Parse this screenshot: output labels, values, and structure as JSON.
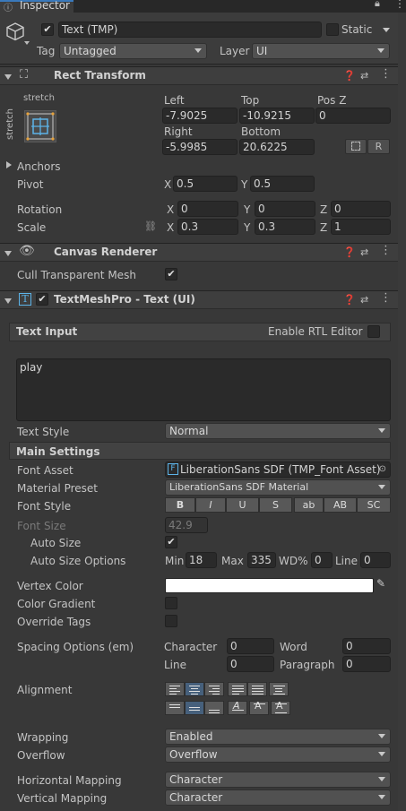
{
  "window": {
    "tab_label": "Inspector",
    "lock_icon": "lock-icon",
    "menu_icon": "kebab-icon"
  },
  "gameobject": {
    "active": true,
    "name": "Text (TMP)",
    "static_label": "Static",
    "tag_label": "Tag",
    "tag_value": "Untagged",
    "layer_label": "Layer",
    "layer_value": "UI"
  },
  "rect_transform": {
    "title": "Rect Transform",
    "anchor_preset_top": "stretch",
    "anchor_preset_side": "stretch",
    "left_label": "Left",
    "left_value": "-7.9025",
    "top_label": "Top",
    "top_value": "-10.9215",
    "posz_label": "Pos Z",
    "posz_value": "0",
    "right_label": "Right",
    "right_value": "-5.9985",
    "bottom_label": "Bottom",
    "bottom_value": "20.6225",
    "raw_button": "R",
    "anchors_label": "Anchors",
    "pivot_label": "Pivot",
    "pivot_x": "0.5",
    "pivot_y": "0.5",
    "rotation_label": "Rotation",
    "rot_x": "0",
    "rot_y": "0",
    "rot_z": "0",
    "scale_label": "Scale",
    "scale_x": "0.3",
    "scale_y": "0.3",
    "scale_z": "1",
    "x": "X",
    "y": "Y",
    "z": "Z"
  },
  "canvas_renderer": {
    "title": "Canvas Renderer",
    "cull_label": "Cull Transparent Mesh",
    "cull_checked": true
  },
  "tmp": {
    "title": "TextMeshPro - Text (UI)",
    "enabled": true,
    "text_input_label": "Text Input",
    "rtl_label": "Enable RTL Editor",
    "text_value": "play",
    "text_style_label": "Text Style",
    "text_style_value": "Normal",
    "main_settings_label": "Main Settings",
    "font_asset_label": "Font Asset",
    "font_asset_value": "LiberationSans SDF (TMP_Font Asset)",
    "material_preset_label": "Material Preset",
    "material_preset_value": "LiberationSans SDF Material",
    "font_style_label": "Font Style",
    "font_style_buttons": [
      "B",
      "I",
      "U",
      "S",
      "ab",
      "AB",
      "SC"
    ],
    "font_size_label": "Font Size",
    "font_size_value": "42.9",
    "auto_size_label": "Auto Size",
    "auto_size_checked": true,
    "auto_size_options_label": "Auto Size Options",
    "min_label": "Min",
    "min_value": "18",
    "max_label": "Max",
    "max_value": "335",
    "wd_label": "WD%",
    "wd_value": "0",
    "line_label": "Line",
    "line_value": "0",
    "vertex_color_label": "Vertex Color",
    "vertex_color": "#ffffff",
    "color_gradient_label": "Color Gradient",
    "override_tags_label": "Override Tags",
    "spacing_label": "Spacing Options (em)",
    "character_label": "Character",
    "character_value": "0",
    "word_label": "Word",
    "word_value": "0",
    "line_sp_label": "Line",
    "line_sp_value": "0",
    "paragraph_label": "Paragraph",
    "paragraph_value": "0",
    "alignment_label": "Alignment",
    "wrapping_label": "Wrapping",
    "wrapping_value": "Enabled",
    "overflow_label": "Overflow",
    "overflow_value": "Overflow",
    "hmap_label": "Horizontal Mapping",
    "hmap_value": "Character",
    "vmap_label": "Vertical Mapping",
    "vmap_value": "Character"
  },
  "colors": {
    "panel": "#383838",
    "accent": "#46607c",
    "field": "#2a2a2a"
  }
}
